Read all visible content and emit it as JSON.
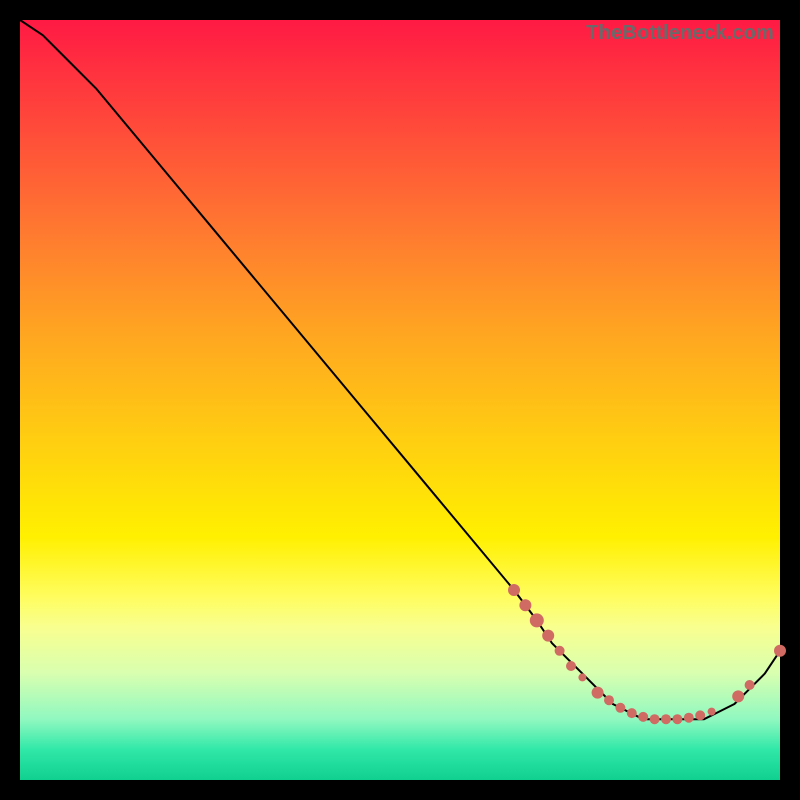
{
  "watermark": "TheBottleneck.com",
  "chart_data": {
    "type": "line",
    "title": "",
    "xlabel": "",
    "ylabel": "",
    "xlim": [
      0,
      100
    ],
    "ylim": [
      0,
      100
    ],
    "grid": false,
    "legend": false,
    "series": [
      {
        "name": "curve",
        "x": [
          0,
          3,
          6,
          10,
          15,
          20,
          25,
          30,
          35,
          40,
          45,
          50,
          55,
          60,
          65,
          68,
          70,
          72,
          74,
          76,
          78,
          80,
          82,
          84,
          86,
          88,
          90,
          92,
          94,
          96,
          98,
          100
        ],
        "y": [
          100,
          98,
          95,
          91,
          85,
          79,
          73,
          67,
          61,
          55,
          49,
          43,
          37,
          31,
          25,
          21,
          18,
          16,
          14,
          12,
          10,
          9,
          8,
          8,
          8,
          8,
          8,
          9,
          10,
          12,
          14,
          17
        ]
      }
    ],
    "markers": [
      {
        "x": 65.0,
        "y": 25.0,
        "r": 6
      },
      {
        "x": 66.5,
        "y": 23.0,
        "r": 6
      },
      {
        "x": 68.0,
        "y": 21.0,
        "r": 7
      },
      {
        "x": 69.5,
        "y": 19.0,
        "r": 6
      },
      {
        "x": 71.0,
        "y": 17.0,
        "r": 5
      },
      {
        "x": 72.5,
        "y": 15.0,
        "r": 5
      },
      {
        "x": 74.0,
        "y": 13.5,
        "r": 4
      },
      {
        "x": 76.0,
        "y": 11.5,
        "r": 6
      },
      {
        "x": 77.5,
        "y": 10.5,
        "r": 5
      },
      {
        "x": 79.0,
        "y": 9.5,
        "r": 5
      },
      {
        "x": 80.5,
        "y": 8.8,
        "r": 5
      },
      {
        "x": 82.0,
        "y": 8.3,
        "r": 5
      },
      {
        "x": 83.5,
        "y": 8.0,
        "r": 5
      },
      {
        "x": 85.0,
        "y": 8.0,
        "r": 5
      },
      {
        "x": 86.5,
        "y": 8.0,
        "r": 5
      },
      {
        "x": 88.0,
        "y": 8.2,
        "r": 5
      },
      {
        "x": 89.5,
        "y": 8.5,
        "r": 5
      },
      {
        "x": 91.0,
        "y": 9.0,
        "r": 4
      },
      {
        "x": 94.5,
        "y": 11.0,
        "r": 6
      },
      {
        "x": 96.0,
        "y": 12.5,
        "r": 5
      },
      {
        "x": 100.0,
        "y": 17.0,
        "r": 6
      }
    ]
  }
}
